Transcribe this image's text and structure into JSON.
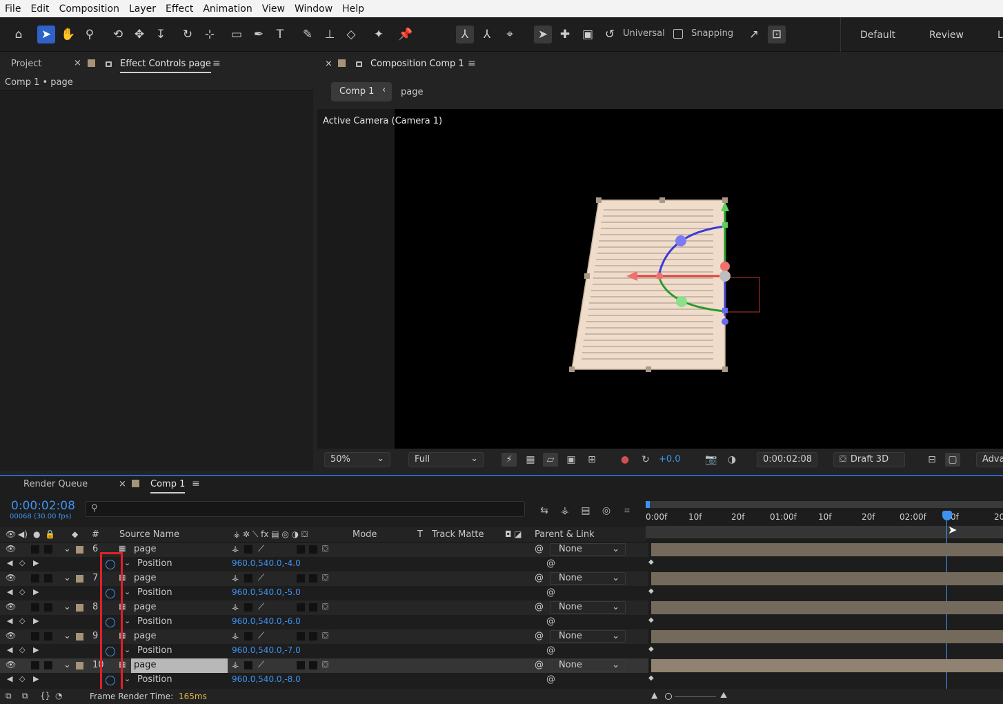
{
  "menu": [
    "File",
    "Edit",
    "Composition",
    "Layer",
    "Effect",
    "Animation",
    "View",
    "Window",
    "Help"
  ],
  "toolbar": {
    "axis_mode": "Universal",
    "snapping_label": "Snapping",
    "workspaces": [
      "Default",
      "Review",
      "L"
    ]
  },
  "left_panel": {
    "tab_project": "Project",
    "tab_effect_controls": "Effect Controls page",
    "breadcrumb": "Comp 1 • page"
  },
  "comp_panel": {
    "tab_label": "Composition Comp 1",
    "breadcrumb_comp": "Comp 1",
    "breadcrumb_layer": "page",
    "camera_label": "Active Camera (Camera 1)",
    "zoom": "50%",
    "resolution": "Full",
    "exposure": "+0.0",
    "timecode": "0:00:02:08",
    "renderer": "Draft 3D",
    "advanced": "Adva"
  },
  "timeline": {
    "tab_render_queue": "Render Queue",
    "tab_comp": "Comp 1",
    "current_time": "0:00:02:08",
    "frame_info": "00068 (30.00 fps)",
    "search_placeholder": "",
    "col_number": "#",
    "col_source_name": "Source Name",
    "col_mode": "Mode",
    "col_t": "T",
    "col_track_matte": "Track Matte",
    "col_parent": "Parent & Link",
    "ruler_ticks": [
      "0:00f",
      "10f",
      "20f",
      "01:00f",
      "10f",
      "20f",
      "02:00f",
      "0f",
      "20"
    ],
    "render_time_label": "Frame Render Time:",
    "render_time_value": "165ms",
    "layers": [
      {
        "num": "6",
        "name": "page",
        "parent": "None",
        "prop": "Position",
        "value": "960.0,540.0,-4.0"
      },
      {
        "num": "7",
        "name": "page",
        "parent": "None",
        "prop": "Position",
        "value": "960.0,540.0,-5.0"
      },
      {
        "num": "8",
        "name": "page",
        "parent": "None",
        "prop": "Position",
        "value": "960.0,540.0,-6.0"
      },
      {
        "num": "9",
        "name": "page",
        "parent": "None",
        "prop": "Position",
        "value": "960.0,540.0,-7.0"
      },
      {
        "num": "10",
        "name": "page",
        "parent": "None",
        "prop": "Position",
        "value": "960.0,540.0,-8.0"
      }
    ]
  },
  "colors": {
    "accent": "#2d63c8",
    "value_blue": "#3d93f0",
    "highlight_red": "#e0202a",
    "layer_label": "#a69478"
  }
}
